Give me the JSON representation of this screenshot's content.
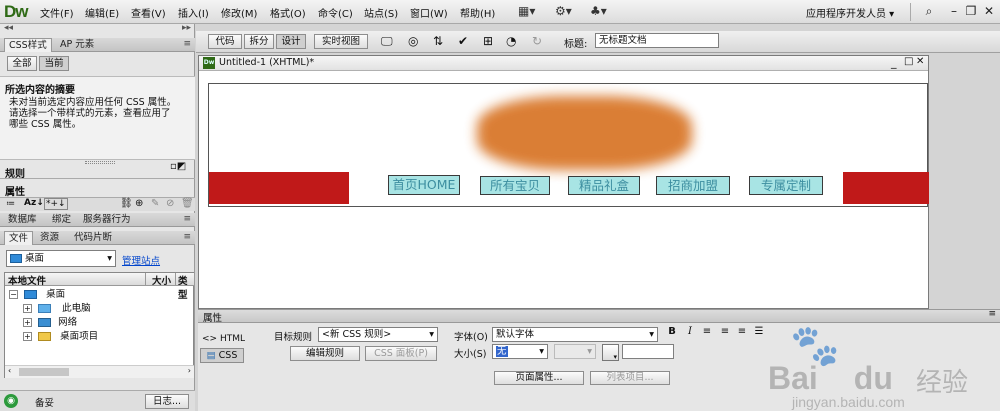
{
  "app": {
    "logo": "Dw",
    "menu": [
      "文件(F)",
      "编辑(E)",
      "查看(V)",
      "插入(I)",
      "修改(M)",
      "格式(O)",
      "命令(C)",
      "站点(S)",
      "窗口(W)",
      "帮助(H)"
    ],
    "workspace": "应用程序开发人员"
  },
  "left_panel": {
    "tabs": [
      "CSS样式",
      "AP 元素"
    ],
    "css_modes": [
      "全部",
      "当前"
    ],
    "summary_title": "所选内容的摘要",
    "summary_text": [
      "未对当前选定内容应用任何 CSS 属性。",
      "请选择一个带样式的元素，查看应用了",
      "哪些 CSS 属性。"
    ],
    "rules_label": "规则",
    "properties_label": "属性",
    "tabs2": [
      "数据库",
      "绑定",
      "服务器行为"
    ],
    "tabs3": [
      "文件",
      "资源",
      "代码片断"
    ],
    "site_select": "桌面",
    "manage_site": "管理站点",
    "file_header": [
      "本地文件",
      "大小",
      "类型"
    ],
    "tree": [
      {
        "label": "桌面",
        "level": 0
      },
      {
        "label": "此电脑",
        "level": 1
      },
      {
        "label": "网络",
        "level": 1
      },
      {
        "label": "桌面项目",
        "level": 1
      }
    ],
    "status": "备妥",
    "log_button": "日志..."
  },
  "doc_toolbar": {
    "views": [
      "代码",
      "拆分",
      "设计",
      "实时视图"
    ],
    "active_view": "设计",
    "title_label": "标题:",
    "title_value": "无标题文档"
  },
  "doc": {
    "tab_title": "Untitled-1 (XHTML)*",
    "nav": [
      "首页HOME",
      "所有宝贝",
      "精品礼盒",
      "招商加盟",
      "专属定制"
    ],
    "colors": {
      "nav_red": "#c01919",
      "nav_button": "#a8e4e4",
      "blur": "#d9782b"
    }
  },
  "properties": {
    "title": "属性",
    "html_tab": "<> HTML",
    "css_tab": "CSS",
    "target_rule_label": "目标规则",
    "target_rule_value": "<新 CSS 规则>",
    "edit_rule": "编辑规则",
    "css_panel": "CSS 面板(P)",
    "font_label": "字体(O)",
    "font_value": "默认字体",
    "size_label": "大小(S)",
    "size_value": "无",
    "page_properties": "页面属性...",
    "list_item": "列表项目..."
  },
  "watermark": {
    "text_baidu": "Bai",
    "text_du": "du",
    "text_jingyan": "经验",
    "url": "jingyan.baidu.com"
  }
}
